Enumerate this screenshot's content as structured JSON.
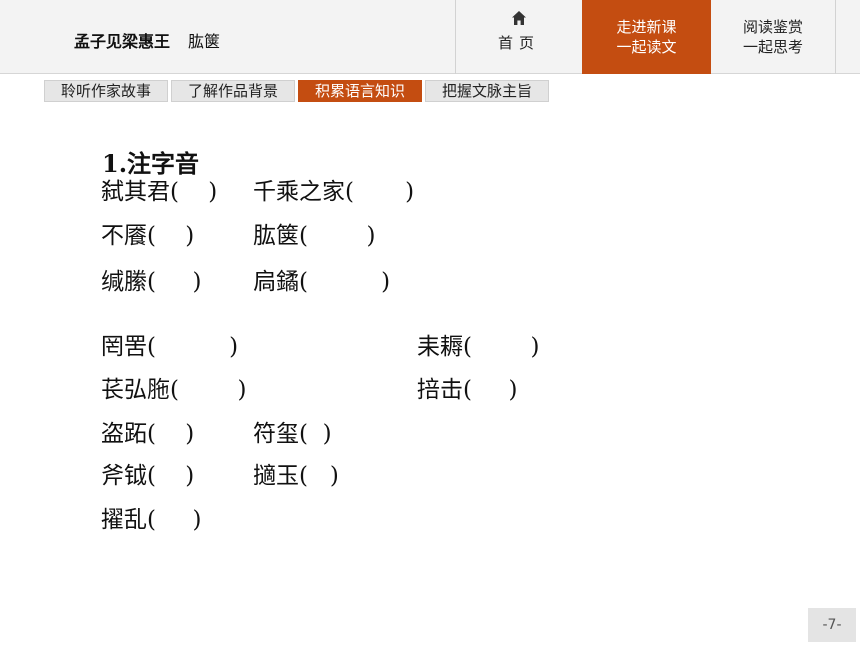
{
  "header": {
    "title_main": "孟子见梁惠王",
    "title_sub": "肱箧",
    "home_label": "首页",
    "nav_active_line1": "走进新课",
    "nav_active_line2": "一起读文",
    "nav_read_line1": "阅读鉴赏",
    "nav_read_line2": "一起思考"
  },
  "tabs": [
    {
      "label": "聆听作家故事"
    },
    {
      "label": "了解作品背景"
    },
    {
      "label": "积累语言知识"
    },
    {
      "label": "把握文脉主旨"
    }
  ],
  "content": {
    "heading": "1.注字音",
    "items": [
      {
        "text": "弑其君(    )"
      },
      {
        "text": "千乘之家(       )"
      },
      {
        "text": "不餍(    )"
      },
      {
        "text": "肱箧(        )"
      },
      {
        "text": "缄縢(     )"
      },
      {
        "text": "扃鐍(          )"
      },
      {
        "text": "罔罟(          )"
      },
      {
        "text": "耒耨(        )"
      },
      {
        "text": "苌弘胣(        )"
      },
      {
        "text": "掊击(     )"
      },
      {
        "text": "盗跖(    )"
      },
      {
        "text": "符玺(  )"
      },
      {
        "text": "斧钺(    )"
      },
      {
        "text": "擿玉(   )"
      },
      {
        "text": "擢乱(     )"
      }
    ]
  },
  "footer": {
    "page_number": "-7-"
  },
  "colors": {
    "accent": "#c44d11",
    "header_bg": "#f3f3f3",
    "tab_bg": "#e6e6e6"
  }
}
